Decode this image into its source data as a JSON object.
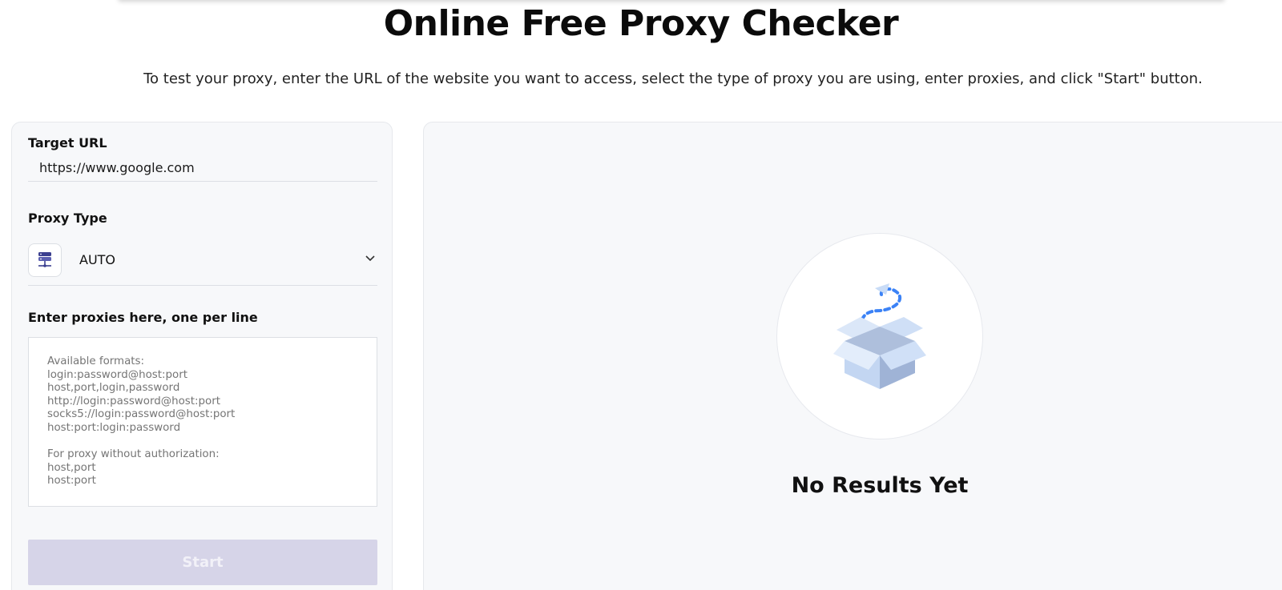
{
  "page": {
    "title": "Online Free Proxy Checker",
    "subtitle": "To test your proxy, enter the URL of the website you want to access, select the type of proxy you are using, enter proxies, and click \"Start\" button."
  },
  "form": {
    "target_url_label": "Target URL",
    "target_url_value": "https://www.google.com",
    "proxy_type_label": "Proxy Type",
    "proxy_type_value": "AUTO",
    "proxies_label": "Enter proxies here, one per line",
    "proxies_placeholder": "Available formats:\nlogin:password@host:port\nhost,port,login,password\nhttp://login:password@host:port\nsocks5://login:password@host:port\nhost:port:login:password\n\nFor proxy without authorization:\nhost,port\nhost:port",
    "start_label": "Start"
  },
  "results": {
    "empty_title": "No Results Yet"
  },
  "colors": {
    "accent_disabled": "#d6d4e8",
    "icon_primary": "#3b3f8f",
    "illustration_blue": "#3b82f6"
  },
  "icons": {
    "proxy_type": "server-network-icon",
    "dropdown": "chevron-down-icon",
    "empty_state": "open-box-illustration"
  }
}
